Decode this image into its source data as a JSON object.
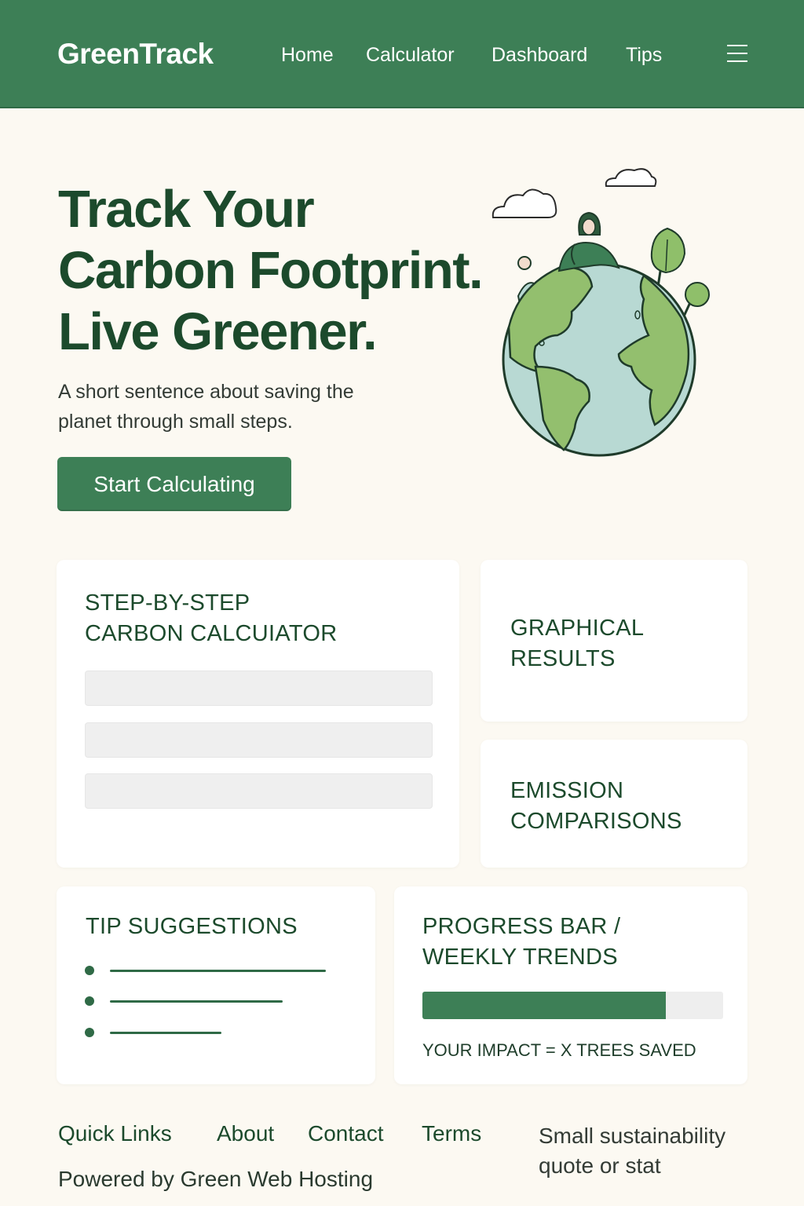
{
  "header": {
    "logo": "GreenTrack",
    "nav": [
      "Home",
      "Calculator",
      "Dashboard",
      "Tips"
    ]
  },
  "hero": {
    "title_lines": [
      "Track Your",
      "Carbon Footprint.",
      "Live Greener."
    ],
    "subtitle": "A short sentence about saving the planet through small steps.",
    "cta": "Start Calculating"
  },
  "cards": {
    "calculator": {
      "title_lines": [
        "STEP-BY-STEP",
        "CARBON CALCUIATOR"
      ],
      "field_count": 3
    },
    "graphical": {
      "title_lines": [
        "GRAPHICAL",
        "RESULTS"
      ]
    },
    "emission": {
      "title_lines": [
        "EMISSION",
        "COMPARISONS"
      ]
    },
    "tips": {
      "title": "TIP SUGGESTIONS",
      "item_count": 3
    },
    "progress": {
      "title_lines": [
        "PROGRESS BAR /",
        "WEEKLY TRENDS"
      ],
      "progress_fraction": 0.81,
      "impact": "YOUR IMPACT = X TREES SAVED"
    }
  },
  "footer": {
    "links": [
      "Quick Links",
      "About",
      "Contact",
      "Terms"
    ],
    "powered_by": "Powered by Green Web Hosting",
    "quote": "Small sustainability quote or stat"
  },
  "colors": {
    "brand": "#3d7f56",
    "dark_text": "#1c4a2c",
    "background": "#fcf9f2",
    "ocean": "#b8d9d3",
    "land": "#93bf6e"
  },
  "icons": [
    "menu-icon",
    "globe-illustration",
    "cloud-icon",
    "tree-icon",
    "person-icon"
  ]
}
